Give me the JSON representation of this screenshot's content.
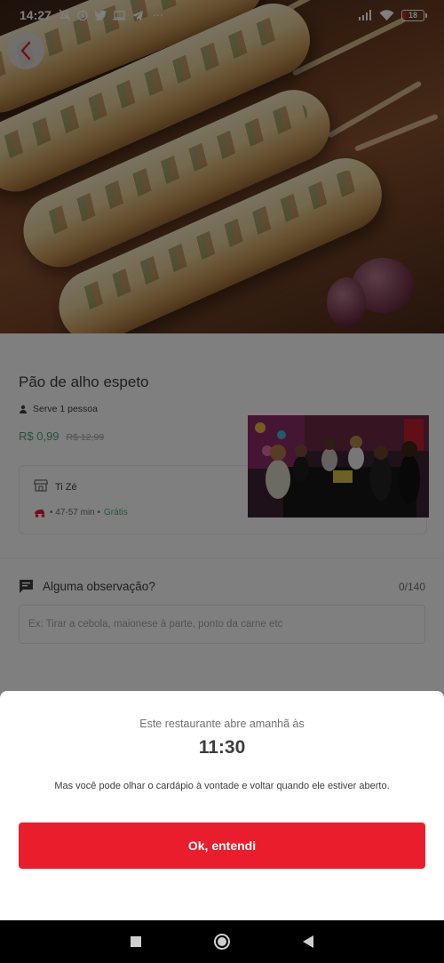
{
  "status_bar": {
    "time": "14:27",
    "battery": "18",
    "icons": [
      "mute-icon",
      "alarm-icon",
      "twitter-icon",
      "laptop-icon",
      "telegram-icon",
      "more-icon",
      "signal-icon",
      "wifi-icon",
      "battery-icon"
    ],
    "more": "⋯"
  },
  "product": {
    "name": "Pão de alho espeto",
    "serves": "Serve 1 pessoa",
    "price": "R$ 0,99",
    "old_price": "R$ 12,99"
  },
  "store": {
    "name": "Ti Zé",
    "delivery_time": "• 47-57 min •",
    "delivery_fee": "Grátis"
  },
  "observation": {
    "label": "Alguma observação?",
    "counter": "0/140",
    "placeholder": "Ex: Tirar a cebola, maionese à parte, ponto da carne etc"
  },
  "closed_sheet": {
    "message": "Este restaurante abre amanhã às",
    "opening_time": "11:30",
    "subtext": "Mas você pode olhar o cardápio à vontade e voltar quando ele estiver aberto.",
    "button_label": "Ok, entendi"
  },
  "colors": {
    "brand_red": "#ea1d2c",
    "price_green": "#50a773"
  }
}
